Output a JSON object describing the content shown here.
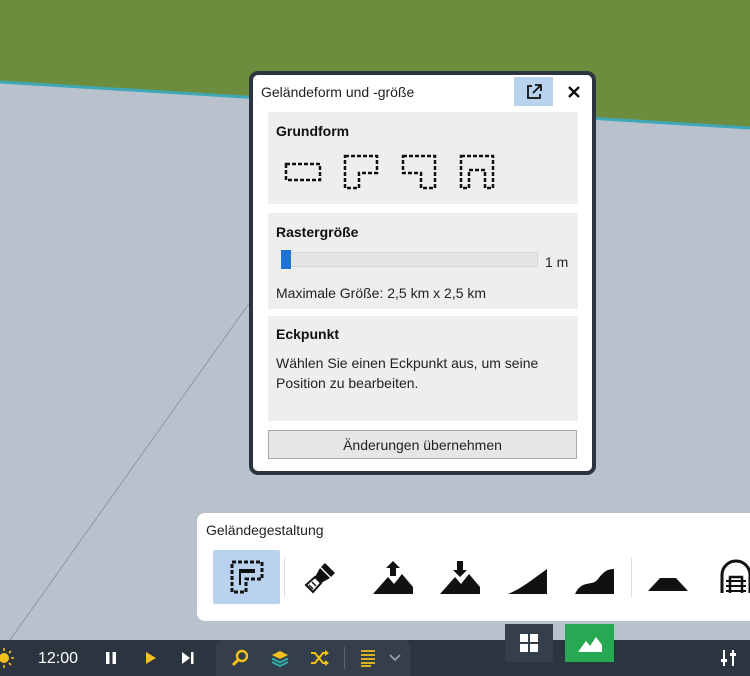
{
  "dialog": {
    "title": "Geländeform und -größe",
    "popout_icon": "external-link-icon",
    "close_icon": "close-icon",
    "base_shape": {
      "title": "Grundform",
      "shapes": [
        "rectangle-shape-icon",
        "l-shape-icon",
        "mirrored-l-shape-icon",
        "u-shape-icon"
      ]
    },
    "grid_size": {
      "title": "Rastergröße",
      "slider_level_fraction": 0.0,
      "value_label": "1 m",
      "max_size_text": "Maximale Größe: 2,5 km x 2,5 km"
    },
    "corner": {
      "title": "Eckpunkt",
      "description": "Wählen Sie einen Eckpunkt aus, um seine Position zu bearbeiten."
    },
    "apply_label": "Änderungen übernehmen"
  },
  "terrain_toolbar": {
    "title": "Geländegestaltung",
    "active_tool": "terrain-shape-tool",
    "tools": [
      "terrain-shape-icon",
      "paint-brush-icon",
      "raise-terrain-icon",
      "lower-terrain-icon",
      "smooth-slope-icon",
      "curved-slope-icon",
      "flatten-mound-icon",
      "tunnel-icon"
    ]
  },
  "bottom_bar": {
    "time": "12:00",
    "icons": [
      "sun-icon",
      "pause-icon",
      "play-icon",
      "skip-forward-icon",
      "search-icon",
      "layers-icon",
      "shuffle-icon",
      "list-icon",
      "chevron-down-icon",
      "grid-view-icon",
      "terrain-mode-icon",
      "sliders-icon"
    ]
  },
  "colors": {
    "accent": "#1d74d3",
    "active_tool_bg": "#b9d3ee",
    "bar_bg": "#2c3440",
    "terrain_tab": "#27a954",
    "grass": "#6d8d3e"
  }
}
